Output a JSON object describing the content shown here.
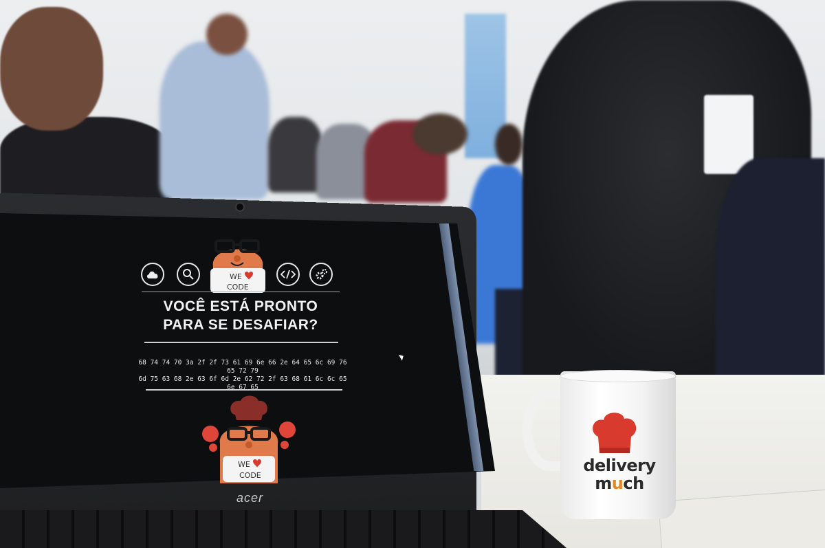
{
  "laptop": {
    "brand": "acer",
    "screen": {
      "icons": [
        "cloud-icon",
        "search-icon",
        "mascot-icon",
        "code-icon",
        "gear-icon"
      ],
      "mascot_badge_top": {
        "line1": "WE",
        "line2": "CODE"
      },
      "headline_line1": "VOCÊ ESTÁ PRONTO",
      "headline_line2": "PARA SE DESAFIAR?",
      "hex_line1": "68 74 74 70 3a 2f 2f 73 61 69 6e 66 2e 64 65 6c 69 76 65 72 79",
      "hex_line2": "6d 75 63 68 2e 63 6f 6d 2e 62 72 2f 63 68 61 6c 6c 65 6e 67 65",
      "mascot_badge_bottom": {
        "line1": "WE",
        "line2": "CODE"
      }
    }
  },
  "mug": {
    "brand_line1": "delivery",
    "brand_line2_a": "m",
    "brand_line2_u": "u",
    "brand_line2_b": "ch"
  },
  "colors": {
    "mascot_orange": "#e07a4a",
    "chef_hat_red": "#d83a2e",
    "brand_orange": "#e9871f",
    "screen_bg": "#0d0e10"
  }
}
